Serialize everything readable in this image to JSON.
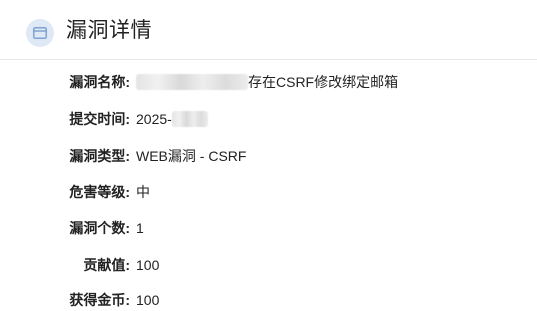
{
  "header": {
    "title": "漏洞详情",
    "icon": "card-icon",
    "icon_color": "#7fa2d2",
    "icon_bg": "#dfe9f6"
  },
  "details": {
    "name": {
      "label": "漏洞名称:",
      "value": "存在CSRF修改绑定邮箱"
    },
    "time": {
      "label": "提交时间:",
      "value": "2025-"
    },
    "type": {
      "label": "漏洞类型:",
      "value": "WEB漏洞 - CSRF"
    },
    "level": {
      "label": "危害等级:",
      "value": "中"
    },
    "count": {
      "label": "漏洞个数:",
      "value": "1"
    },
    "contribution": {
      "label": "贡献值:",
      "value": "100"
    },
    "coins": {
      "label": "获得金币:",
      "value": "100"
    }
  }
}
